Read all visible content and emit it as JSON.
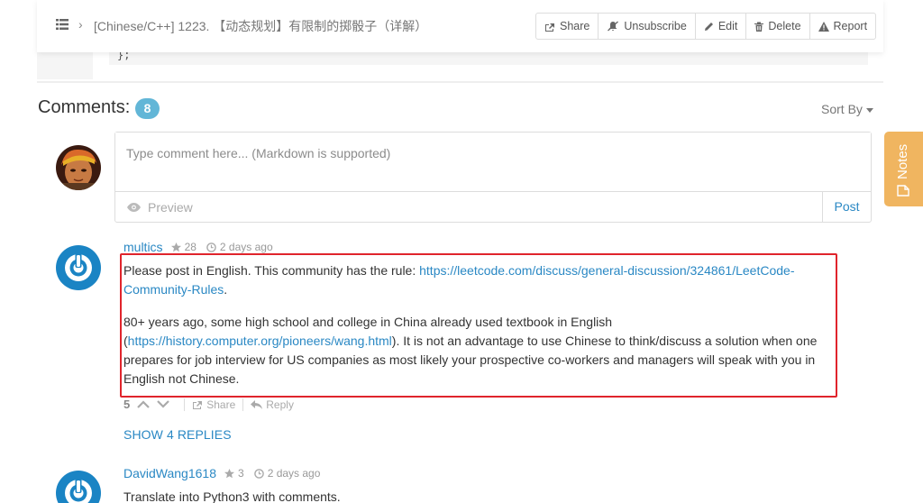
{
  "header": {
    "title": "[Chinese/C++] 1223. 【动态规划】有限制的掷骰子（详解）",
    "buttons": {
      "share": "Share",
      "unsubscribe": "Unsubscribe",
      "edit": "Edit",
      "delete": "Delete",
      "report": "Report"
    }
  },
  "prev_code_snippet": "};",
  "comments_section": {
    "title": "Comments:",
    "count": "8",
    "sort_label": "Sort By"
  },
  "composer": {
    "placeholder": "Type comment here... (Markdown is supported)",
    "preview_label": "Preview",
    "post_label": "Post"
  },
  "notes_tab": {
    "label": "Notes"
  },
  "comments": [
    {
      "author": "multics",
      "reputation": "28",
      "time": "2 days ago",
      "para1_text": "Please post in English. This community has the rule: ",
      "para1_link": "https://leetcode.com/discuss/general-discussion/324861/LeetCode-Community-Rules",
      "para1_end": ".",
      "para2_start": "80+ years ago, some high school and college in China already used textbook in English (",
      "para2_link": "https://history.computer.org/pioneers/wang.html",
      "para2_end": "). It is not an advantage to use Chinese to think/discuss a solution when one prepares for job interview for US companies as most likely your prospective co-workers and managers will speak with you in English not Chinese.",
      "votes": "5",
      "share_label": "Share",
      "reply_label": "Reply",
      "show_replies": "SHOW 4 REPLIES"
    },
    {
      "author": "DavidWang1618",
      "reputation": "3",
      "time": "2 days ago",
      "text": "Translate into Python3 with comments."
    }
  ],
  "colors": {
    "link": "#2a88c4",
    "badge": "#62b6d7",
    "notes_tab": "#f0b560",
    "highlight_border": "#e0242c"
  }
}
